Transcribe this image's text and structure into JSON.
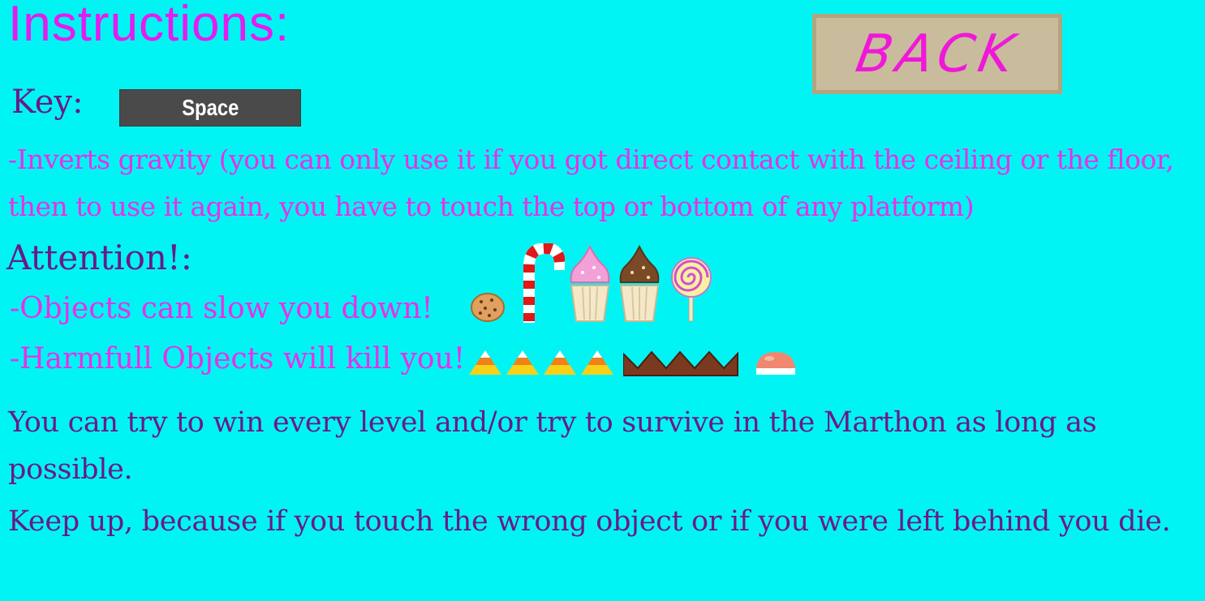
{
  "title": "Instructions:",
  "back_button": "BACK",
  "key": {
    "label": "Key:",
    "key_name": "Space",
    "description": "-Inverts gravity (you can only use it if you got direct contact with the ceiling or the floor, then to use it again, you have to touch the top or bottom of any platform)"
  },
  "attention": {
    "label": "Attention!:",
    "slow_objects": "-Objects can slow you down!",
    "harmful_objects": "-Harmfull Objects will kill you!"
  },
  "objectives": {
    "win": "You can try to win every level and/or try to survive in the Marthon as long as possible.",
    "keep_up": "Keep up, because if you touch the wrong object or if you were left behind you die."
  },
  "icons": {
    "slow": [
      "cookie-icon",
      "candy-cane-icon",
      "pink-cupcake-icon",
      "chocolate-cupcake-icon",
      "lollipop-icon"
    ],
    "harmful": [
      "candy-corn-spikes-icon",
      "chocolate-spikes-icon",
      "gumdrop-icon"
    ]
  },
  "colors": {
    "background": "#00f4f4",
    "title": "#e41cf0",
    "pink_text": "#e830e8",
    "purple_text": "#6a1a86",
    "button_bg": "#c8bc9c"
  }
}
